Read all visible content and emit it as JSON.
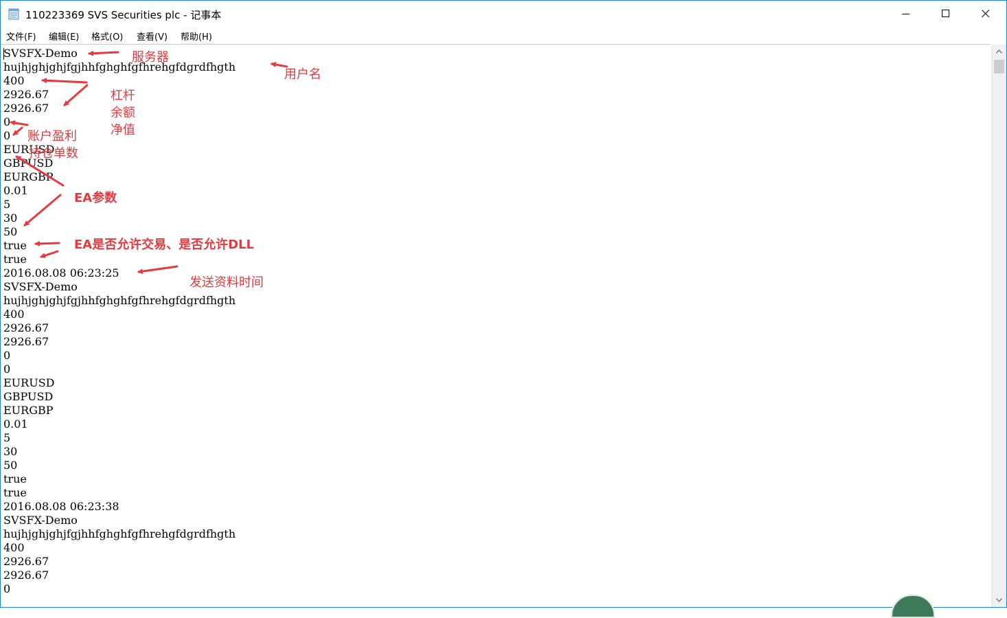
{
  "window": {
    "title": "110223369  SVS Securities plc - 记事本",
    "app_icon": "notepad-icon",
    "controls": [
      "minimize-icon",
      "maximize-icon",
      "close-icon"
    ]
  },
  "menu": {
    "items": [
      "文件(F)",
      "编辑(E)",
      "格式(O)",
      "查看(V)",
      "帮助(H)"
    ]
  },
  "document": {
    "lines": [
      "SVSFX-Demo",
      "hujhjghjghjfgjhhfghghfgfhrehgfdgrdfhgth",
      "400",
      "2926.67",
      "2926.67",
      "0",
      "0",
      "EURUSD",
      "GBPUSD",
      "EURGBP",
      "0.01",
      "5",
      "30",
      "50",
      "true",
      "true",
      "2016.08.08 06:23:25",
      "SVSFX-Demo",
      "hujhjghjghjfgjhhfghghfgfhrehgfdgrdfhgth",
      "400",
      "2926.67",
      "2926.67",
      "0",
      "0",
      "EURUSD",
      "GBPUSD",
      "EURGBP",
      "0.01",
      "5",
      "30",
      "50",
      "true",
      "true",
      "2016.08.08 06:23:38",
      "SVSFX-Demo",
      "hujhjghjghjfgjhhfghghfgfhrehgfdgrdfhgth",
      "400",
      "2926.67",
      "2926.67",
      "0"
    ]
  },
  "annotations": {
    "color": "#e8383d",
    "server": "服务器",
    "username": "用户名",
    "leverage": "杠杆",
    "balance": "余额",
    "equity": "净值",
    "account_profit": "账户盈利",
    "open_orders": "持仓单数",
    "ea_params": "EA参数",
    "ea_allow": "EA是否允许交易、是否允许DLL",
    "send_time": "发送资料时间"
  },
  "scrollbar": {
    "up_icon": "chevron-up-icon",
    "down_icon": "chevron-down-icon"
  }
}
